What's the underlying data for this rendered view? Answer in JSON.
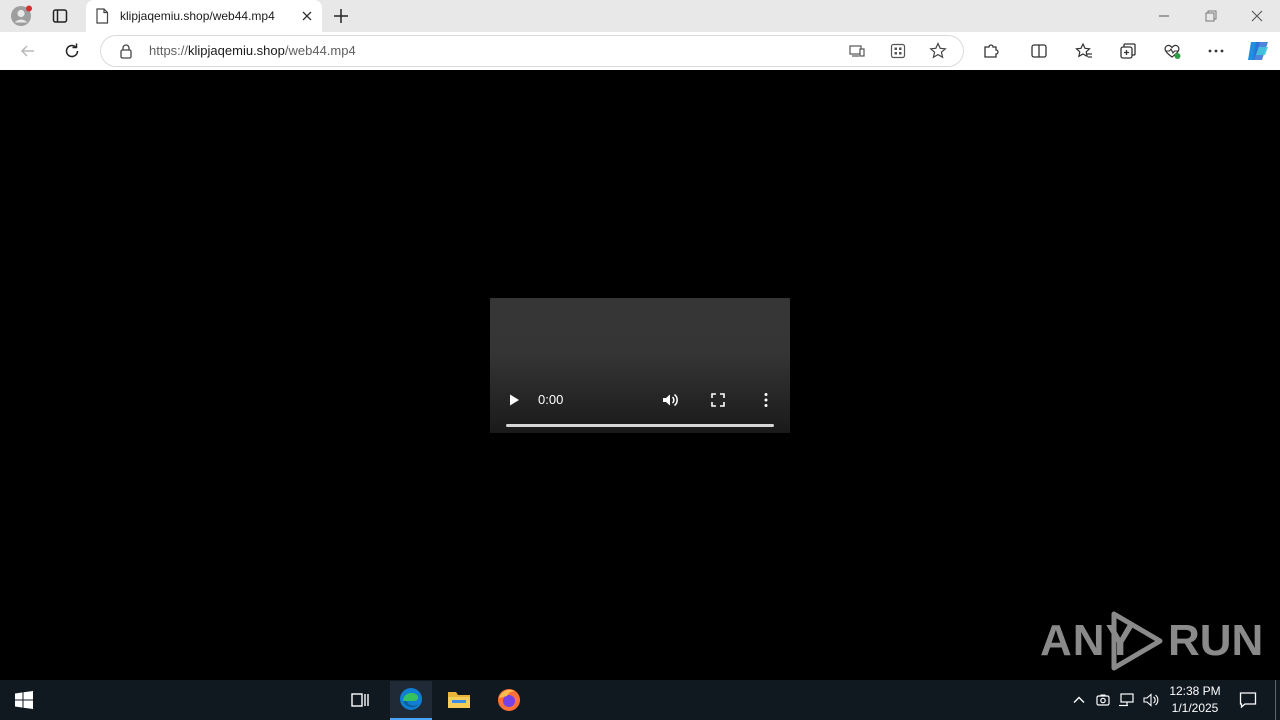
{
  "browser": {
    "tab_title": "klipjaqemiu.shop/web44.mp4",
    "url_prefix": "https://",
    "url_host": "klipjaqemiu.shop",
    "url_path": "/web44.mp4"
  },
  "video": {
    "time": "0:00"
  },
  "watermark": {
    "left": "ANY",
    "right": "RUN"
  },
  "taskbar": {
    "time": "12:38 PM",
    "date": "1/1/2025"
  },
  "colors": {
    "accent": "#0078d4",
    "taskbar": "#101820"
  }
}
